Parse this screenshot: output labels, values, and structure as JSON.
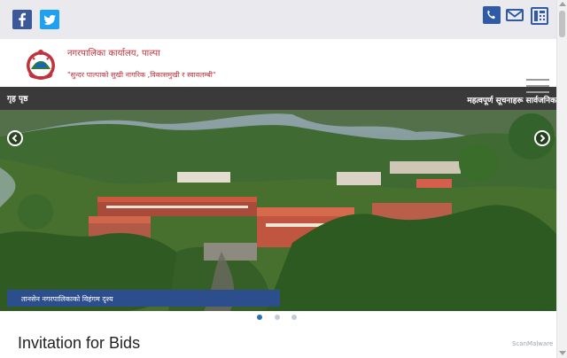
{
  "social": {
    "facebook_icon": "facebook-icon",
    "twitter_icon": "twitter-icon"
  },
  "contact": {
    "phone_icon": "phone-icon",
    "mail_icon": "mail-icon",
    "fax_icon": "fax-icon"
  },
  "header": {
    "office_name": "नगरपालिका कार्यालय, पाल्पा",
    "tagline": "\"सुन्दर पाल्पाको सुखी नागरिक ,विकासमुखी र स्वावलम्बी\""
  },
  "nav": {
    "home_label": "गृह पृष्ठ",
    "marquee_text": "महत्वपूर्ण सूचनाहरू सार्वजनिक"
  },
  "slider": {
    "caption": "तानसेन नगरपालिकाको विहंगम दृश्य",
    "active_index": 0,
    "slide_count": 3
  },
  "main": {
    "section_title": "Invitation for Bids"
  },
  "watermark": {
    "text": "ScanMalware"
  },
  "colors": {
    "topbar_bg": "#e9e9ee",
    "brand_red": "#c0333c",
    "nav_dark": "#3a3a3a",
    "caption_blue": "#2d4e8c",
    "icon_blue": "#2f5aa8"
  }
}
